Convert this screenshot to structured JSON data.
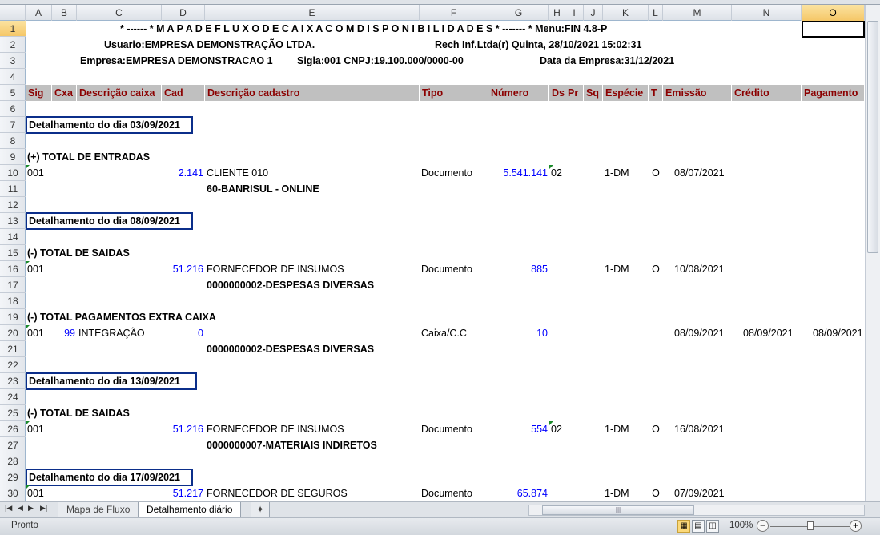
{
  "columns": [
    "A",
    "B",
    "C",
    "D",
    "E",
    "F",
    "G",
    "H",
    "I",
    "J",
    "K",
    "L",
    "M",
    "N",
    "O"
  ],
  "selected_cell": "O1",
  "header_lines": {
    "title": "* ------ * M A P A   D E   F L U X O   D E   C A I X A   C O M   D I S P O N I B I L I D A D E S * ------- * Menu:FIN 4.8-P",
    "usuario": "Usuario:EMPRESA DEMONSTRAÇÃO LTDA.",
    "rech": "Rech Inf.Ltda(r)  Quinta, 28/10/2021 15:02:31",
    "empresa": "Empresa:EMPRESA DEMONSTRACAO 1",
    "sigla": "Sigla:001  CNPJ:19.100.000/0000-00",
    "data_empresa": "Data da Empresa:31/12/2021"
  },
  "table_headers": {
    "A": "Sig",
    "B": "Cxa",
    "C": "Descrição caixa",
    "D": "Cad",
    "E": "Descrição cadastro",
    "F": "Tipo",
    "G": "Número",
    "H": "Ds",
    "I": "Pr",
    "J": "Sq",
    "K": "Espécie",
    "L": "T",
    "M": "Emissão",
    "N": "Crédito",
    "O": "Pagamento"
  },
  "rows": [
    {
      "n": 7,
      "section": "Detalhamento do dia 03/09/2021"
    },
    {
      "n": 9,
      "group": "(+) TOTAL DE ENTRADAS"
    },
    {
      "n": 10,
      "cells": {
        "A": "001",
        "D": "2.141",
        "E": "CLIENTE 010",
        "F": "Documento",
        "G": "5.541.141",
        "H": "02",
        "K": "1-DM",
        "L": "O",
        "M": "08/07/2021"
      }
    },
    {
      "n": 11,
      "cells": {
        "E": "60-BANRISUL - ONLINE"
      }
    },
    {
      "n": 13,
      "section": "Detalhamento do dia 08/09/2021"
    },
    {
      "n": 15,
      "group": "(-) TOTAL DE SAIDAS"
    },
    {
      "n": 16,
      "cells": {
        "A": "001",
        "D": "51.216",
        "E": "FORNECEDOR DE INSUMOS",
        "F": "Documento",
        "G": "885",
        "K": "1-DM",
        "L": "O",
        "M": "10/08/2021"
      }
    },
    {
      "n": 17,
      "cells": {
        "E": "0000000002-DESPESAS DIVERSAS"
      }
    },
    {
      "n": 19,
      "group": "(-) TOTAL PAGAMENTOS EXTRA CAIXA"
    },
    {
      "n": 20,
      "cells": {
        "A": "001",
        "B": "99",
        "C": "INTEGRAÇÃO",
        "D": "0",
        "F": "Caixa/C.C",
        "G": "10",
        "M": "08/09/2021",
        "N": "08/09/2021",
        "O": "08/09/2021"
      }
    },
    {
      "n": 21,
      "cells": {
        "E": "0000000002-DESPESAS DIVERSAS"
      }
    },
    {
      "n": 23,
      "section": "Detalhamento do dia 13/09/2021"
    },
    {
      "n": 25,
      "group": "(-) TOTAL DE SAIDAS"
    },
    {
      "n": 26,
      "cells": {
        "A": "001",
        "D": "51.216",
        "E": "FORNECEDOR DE INSUMOS",
        "F": "Documento",
        "G": "554",
        "H": "02",
        "K": "1-DM",
        "L": "O",
        "M": "16/08/2021"
      }
    },
    {
      "n": 27,
      "cells": {
        "E": "0000000007-MATERIAIS INDIRETOS"
      }
    },
    {
      "n": 29,
      "section": "Detalhamento do dia 17/09/2021"
    },
    {
      "n": 30,
      "cells": {
        "A": "001",
        "D": "51.217",
        "E": "FORNECEDOR DE SEGUROS",
        "F": "Documento",
        "G": "65.874",
        "K": "1-DM",
        "L": "O",
        "M": "07/09/2021"
      }
    }
  ],
  "sheet_tabs": [
    "Mapa de Fluxo",
    "Detalhamento diário"
  ],
  "active_tab": "Detalhamento diário",
  "status": {
    "text": "Pronto",
    "zoom": "100%",
    "zoom_percent": 100
  },
  "colors": {
    "header_text": "#8b0000",
    "number": "#0000ff",
    "section_border": "#0b2e8a"
  }
}
